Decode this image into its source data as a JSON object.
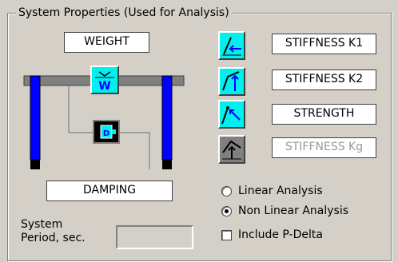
{
  "group": {
    "title": "System Properties (Used for Analysis)"
  },
  "fields": {
    "weight": "WEIGHT",
    "damping": "DAMPING",
    "stiffness_k1": "STIFFNESS K1",
    "stiffness_k2": "STIFFNESS K2",
    "strength": "STRENGTH",
    "stiffness_kg": "STIFFNESS Kg"
  },
  "diagram": {
    "weight_symbol": "W",
    "damper_symbol": "D"
  },
  "options": {
    "linear": "Linear Analysis",
    "nonlinear": "Non Linear Analysis",
    "selected": "nonlinear",
    "pdelta": "Include P-Delta",
    "pdelta_checked": false
  },
  "period": {
    "line1": "System",
    "line2": "Period, sec.",
    "value": ""
  },
  "icons": {
    "k1": "linear-stiffness-icon",
    "k2": "bilinear-stiffness-icon",
    "strength": "yield-strength-icon",
    "kg": "geometric-stiffness-icon"
  },
  "colors": {
    "frame": "#808080",
    "columns": "#0000ff",
    "icon_bg": "#00f0f0",
    "disabled": "#808080"
  }
}
